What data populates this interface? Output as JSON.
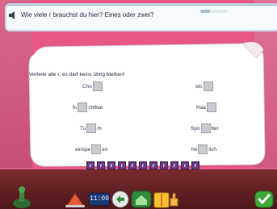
{
  "banner": {
    "question": "Wie viele r brauchst du hier? Eines oder zwei?",
    "progress": 0.35
  },
  "task": {
    "instruction": "Verteile alle r, es darf keins übrig bleiben!",
    "words_left": [
      {
        "pre": "Cho",
        "post": ""
      },
      {
        "pre": "fu",
        "post": "chtbar"
      },
      {
        "pre": "Tu",
        "post": "m"
      },
      {
        "pre": "einspe",
        "post": "en"
      }
    ],
    "words_right": [
      {
        "pre": "sto",
        "post": ""
      },
      {
        "pre": "Haa",
        "post": ""
      },
      {
        "pre": "Spo",
        "post": "tler"
      },
      {
        "pre": "he",
        "post": "lich"
      }
    ],
    "tiles": [
      "r",
      "r",
      "r",
      "r",
      "r",
      "r",
      "r",
      "r",
      "r",
      "r",
      "r"
    ]
  },
  "toolbar": {
    "clock": "11:00"
  },
  "colors": {
    "background": "#e65883",
    "tile": "#6b3d86",
    "clock": "#1b3b78",
    "check": "#3faa3a"
  }
}
